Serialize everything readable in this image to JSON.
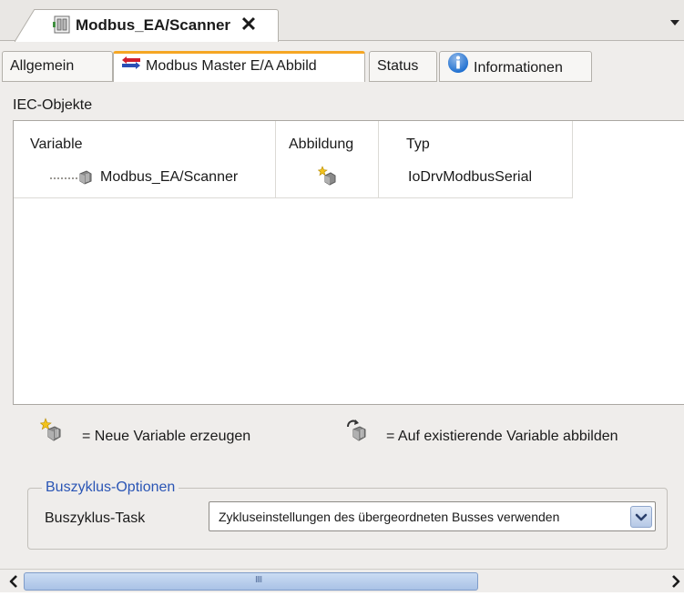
{
  "document_tab": {
    "title": "Modbus_EA/Scanner",
    "close_glyph": "✕"
  },
  "subtabs": [
    {
      "label": "Allgemein",
      "active": false
    },
    {
      "label": "Modbus Master E/A Abbild",
      "active": true
    },
    {
      "label": "Status",
      "active": false
    },
    {
      "label": "Informationen",
      "active": false
    }
  ],
  "section_label": "IEC-Objekte",
  "table": {
    "columns": [
      "Variable",
      "Abbildung",
      "Typ"
    ],
    "rows": [
      {
        "variable": "Modbus_EA/Scanner",
        "typ": "IoDrvModbusSerial"
      }
    ]
  },
  "legend": {
    "new_variable": "= Neue Variable erzeugen",
    "map_existing": "= Auf existierende Variable abbilden"
  },
  "bus_cycle": {
    "group_title": "Buszyklus-Optionen",
    "field_label": "Buszyklus-Task",
    "selected_value": "Zykluseinstellungen des übergeordneten Busses verwenden"
  },
  "hscroll": {
    "thumb_grip": "IIII"
  },
  "colors": {
    "active_tab_accent": "#f5a623",
    "group_title": "#2a55b5",
    "info_icon": "#1e6fd0",
    "io_icon_red": "#d01e2e",
    "io_icon_blue": "#2a4fb5"
  },
  "icons": [
    "device-tab-icon",
    "close-icon",
    "chevron-down-icon",
    "io-arrows-icon",
    "info-icon",
    "device-icon",
    "star-sparkle-icon",
    "arrow-device-icon",
    "scroll-left-icon",
    "scroll-right-icon"
  ]
}
